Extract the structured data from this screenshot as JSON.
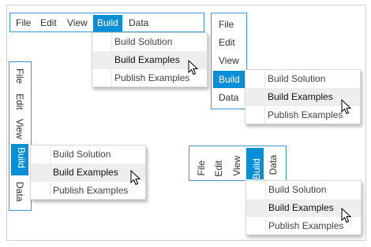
{
  "menus": {
    "horizontal": {
      "items": [
        "File",
        "Edit",
        "View",
        "Build",
        "Data"
      ],
      "selected": "Build"
    },
    "vertical_right": {
      "items": [
        "File",
        "Edit",
        "View",
        "Build",
        "Data"
      ],
      "selected": "Build"
    },
    "vertical_left_rotated": {
      "items": [
        "File",
        "Edit",
        "View",
        "Build",
        "Data"
      ],
      "selected": "Build"
    },
    "vertical_text_bottom": {
      "items": [
        "File",
        "Edit",
        "View",
        "Build",
        "Data"
      ],
      "selected": "Build"
    }
  },
  "dropdown": {
    "items": [
      "Build Solution",
      "Build Examples",
      "Publish Examples"
    ],
    "hovered": "Build Examples"
  },
  "colors": {
    "accent": "#0a8fd6",
    "border": "#3b9ad9",
    "hover": "#eeeeee"
  },
  "icons": {
    "cursor": "mouse-pointer-icon"
  }
}
